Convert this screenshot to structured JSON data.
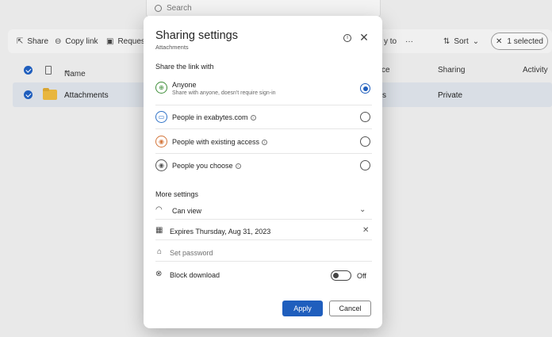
{
  "background": {
    "search": {
      "placeholder": "Search"
    },
    "toolbar": {
      "share": "Share",
      "copy_link": "Copy link",
      "request": "Request",
      "move_to": "y to",
      "more": "···",
      "sort": "Sort",
      "selected": "1 selected"
    },
    "table": {
      "headers": {
        "name": "Name",
        "modified": "ce",
        "sharing": "Sharing",
        "activity": "Activity"
      },
      "rows": [
        {
          "name": "Attachments",
          "modified": "s",
          "sharing": "Private"
        }
      ]
    }
  },
  "dialog": {
    "title": "Sharing settings",
    "subtitle": "Attachments",
    "share_with_heading": "Share the link with",
    "options": [
      {
        "label": "Anyone",
        "description": "Share with anyone, doesn't require sign-in",
        "selected": true,
        "icon": "globe-icon",
        "color": "#3f8f3a"
      },
      {
        "label": "People in exabytes.com",
        "selected": false,
        "icon": "briefcase-icon",
        "color": "#2f72c7"
      },
      {
        "label": "People with existing access",
        "selected": false,
        "icon": "person-icon",
        "color": "#d4763b"
      },
      {
        "label": "People you choose",
        "selected": false,
        "icon": "person-icon",
        "color": "#555555"
      }
    ],
    "more_settings_heading": "More settings",
    "permission": "Can view",
    "expires": "Expires Thursday, Aug 31, 2023",
    "password_placeholder": "Set password",
    "block_download": "Block download",
    "block_download_state": "Off",
    "apply": "Apply",
    "cancel": "Cancel"
  },
  "colors": {
    "accent": "#1f5ebd",
    "row_selected": "#d9dee5"
  }
}
